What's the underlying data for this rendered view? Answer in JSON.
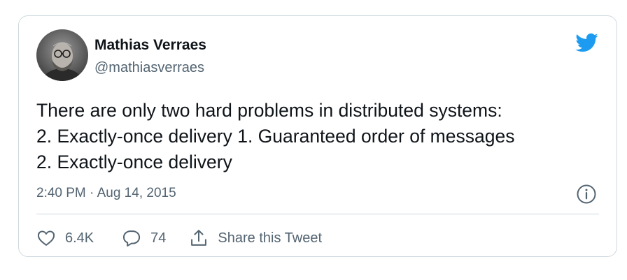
{
  "author": {
    "name": "Mathias Verraes",
    "handle": "@mathiasverraes"
  },
  "tweet": {
    "lines": [
      "There are only two hard problems in distributed systems:",
      "2. Exactly-once delivery 1. Guaranteed order of messages",
      "2. Exactly-once delivery"
    ],
    "timestamp": "2:40 PM · Aug 14, 2015"
  },
  "actions": {
    "likes": "6.4K",
    "replies": "74",
    "share_label": "Share this Tweet"
  },
  "icons": {
    "brand": "twitter-bird-icon",
    "info": "info-icon",
    "like": "heart-icon",
    "reply": "speech-bubble-icon",
    "share": "share-icon"
  },
  "colors": {
    "brand": "#1d9bf0",
    "text_primary": "#0f1419",
    "text_secondary": "#536471",
    "border": "#cfd9de"
  }
}
